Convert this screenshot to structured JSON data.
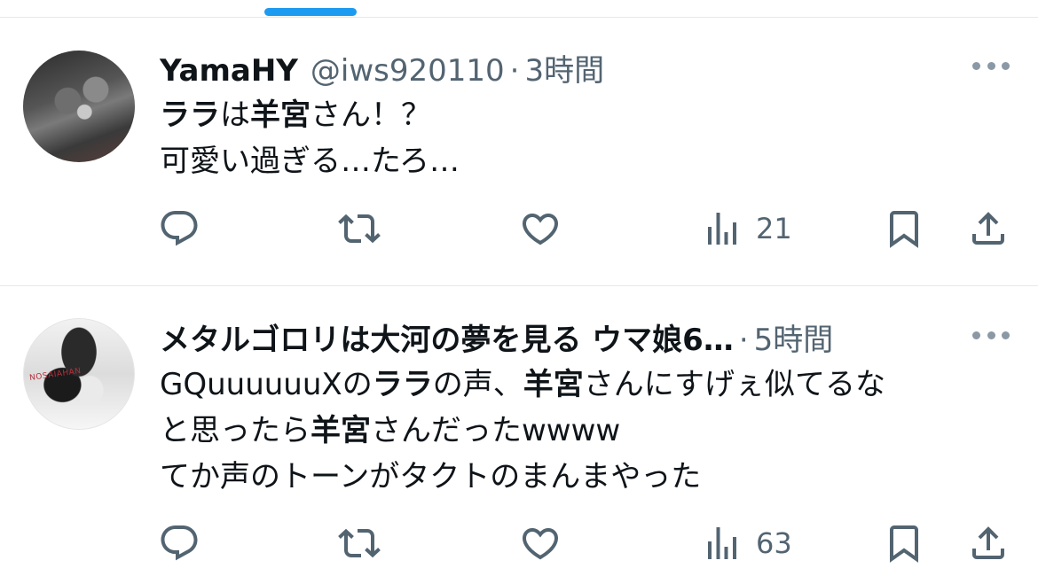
{
  "colors": {
    "accent": "#1d9bf0",
    "text": "#0f1419",
    "secondary": "#536471",
    "divider": "#e6e9ec"
  },
  "tweets": [
    {
      "name": "YamaHY",
      "handle": "@iws920110",
      "dot": "·",
      "time": "3時間",
      "avatar_icon": "user-avatar-robot-figure",
      "body": [
        [
          {
            "text": "ララ",
            "bold": true
          },
          {
            "text": "は",
            "bold": false
          },
          {
            "text": "羊宮",
            "bold": true
          },
          {
            "text": "さん！？",
            "bold": false
          }
        ],
        [
          {
            "text": "可愛い過ぎる…たろ…",
            "bold": false
          }
        ]
      ],
      "views": "21"
    },
    {
      "name": "メタルゴロリは大河の夢を見る ウマ娘6…",
      "handle": "",
      "dot": "·",
      "time": "5時間",
      "avatar_icon": "user-avatar-anime-girl",
      "avatar_watermark": "NOSAIAHAN",
      "body": [
        [
          {
            "text": "GQuuuuuuXの",
            "bold": false
          },
          {
            "text": "ララ",
            "bold": true
          },
          {
            "text": "の声、",
            "bold": false
          },
          {
            "text": "羊宮",
            "bold": true
          },
          {
            "text": "さんにすげぇ似てるな",
            "bold": false
          }
        ],
        [
          {
            "text": "と思ったら",
            "bold": false
          },
          {
            "text": "羊宮",
            "bold": true
          },
          {
            "text": "さんだったwwww",
            "bold": false
          }
        ],
        [
          {
            "text": "てか声のトーンがタクトのまんまやった",
            "bold": false
          }
        ]
      ],
      "views": "63"
    }
  ],
  "icons": [
    "reply-icon",
    "retweet-icon",
    "like-icon",
    "views-icon",
    "bookmark-icon",
    "share-icon",
    "more-icon"
  ]
}
